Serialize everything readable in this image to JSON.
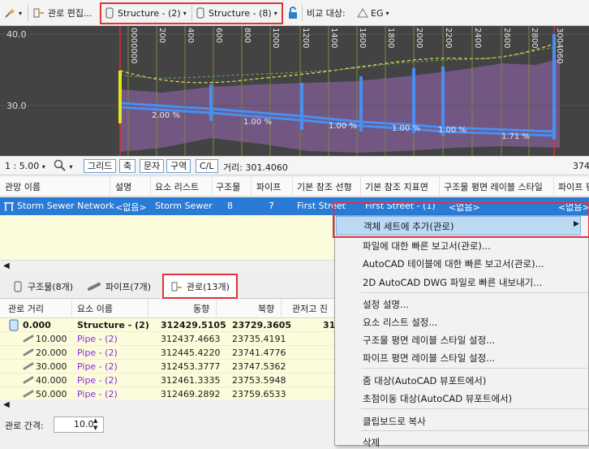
{
  "toolbar": {
    "align_edit_label": "관로 편집...",
    "structure_dropdown_1": "Structure - (2)",
    "structure_dropdown_2": "Structure - (8)",
    "compare_label": "비교 대상:",
    "compare_value": "EG"
  },
  "profile": {
    "elevation_labels": [
      "40.0",
      "30.0"
    ],
    "station_labels": [
      "0+000000",
      "0+00200",
      "0+00400",
      "0+00600",
      "0+00800",
      "0+01000",
      "0+01200",
      "0+01400",
      "0+01600",
      "0+01800",
      "0+02000",
      "0+02200",
      "0+02400",
      "0+02600",
      "0+02800",
      "0+03004060"
    ],
    "station_text": [
      "0000000",
      "200",
      "400",
      "600",
      "800",
      "1000",
      "1200",
      "1400",
      "1600",
      "1800",
      "2000",
      "2200",
      "2400",
      "2600",
      "2800",
      "3004060"
    ],
    "slope_labels": [
      "2.00 %",
      "1.00 %",
      "1.00 %",
      "1.00 %",
      "1.00 %",
      "1.71 %"
    ],
    "colors": {
      "background": "#444444",
      "purple_band": "#7a5a8e",
      "pipe": "#3a7de0",
      "ground": "#d8d85a",
      "red_line": "#e03030"
    }
  },
  "statusbar": {
    "scale": "1 : 5.00",
    "buttons": [
      "그리드",
      "축",
      "문자",
      "구역",
      "C/L"
    ],
    "distance": "거리: 301.4060",
    "right_value": "374"
  },
  "grid": {
    "headers": [
      "관망 이름",
      "설명",
      "요소 리스트",
      "구조물",
      "파이프",
      "기본 참조 선형",
      "기본 참조 지표면",
      "구조물 평면 레이블 스타일",
      "파이프 평"
    ],
    "row": {
      "name": "Storm Sewer Network",
      "desc": "<없음>",
      "parts_list": "Storm Sewer",
      "structures": "8",
      "pipes": "7",
      "alignment": "First Street",
      "surface": "First Street - (1)",
      "label_style": "<없음>",
      "pipe_style": "<없음>"
    }
  },
  "tabs": {
    "structures": "구조물(8개)",
    "pipes": "파이프(7개)",
    "alignment": "관로(13개)"
  },
  "lower_table": {
    "headers": [
      "관로 거리",
      "요소 이름",
      "동향",
      "북향",
      "관저고 진"
    ],
    "rows": [
      {
        "dist": "0.000",
        "name": "Structure - (2)",
        "east": "312429.5105",
        "north": "23729.3605",
        "invert": "31"
      },
      {
        "dist": "10.000",
        "name": "Pipe - (2)",
        "east": "312437.4663",
        "north": "23735.4191",
        "invert": ""
      },
      {
        "dist": "20.000",
        "name": "Pipe - (2)",
        "east": "312445.4220",
        "north": "23741.4776",
        "invert": ""
      },
      {
        "dist": "30.000",
        "name": "Pipe - (2)",
        "east": "312453.3777",
        "north": "23747.5362",
        "invert": ""
      },
      {
        "dist": "40.000",
        "name": "Pipe - (2)",
        "east": "312461.3335",
        "north": "23753.5948",
        "invert": ""
      },
      {
        "dist": "50.000",
        "name": "Pipe - (2)",
        "east": "312469.2892",
        "north": "23759.6533",
        "invert": ""
      }
    ]
  },
  "bottom": {
    "interval_label": "관로 간격:",
    "interval_value": "10.0"
  },
  "context_menu": {
    "items": [
      "객체 세트에 추가(관로)",
      "파일에 대한 빠른 보고서(관로)...",
      "AutoCAD 테이블에 대한 빠른 보고서(관로)...",
      "2D AutoCAD DWG 파일로 빠른 내보내기...",
      "설정 설명...",
      "요소 리스트 설정...",
      "구조물 평면 레이블 스타일 설정...",
      "파이프 평면 레이블 스타일 설정...",
      "줌 대상(AutoCAD 뷰포트에서)",
      "초점이동 대상(AutoCAD 뷰포트에서)",
      "클립보드로 복사",
      "삭제"
    ]
  }
}
